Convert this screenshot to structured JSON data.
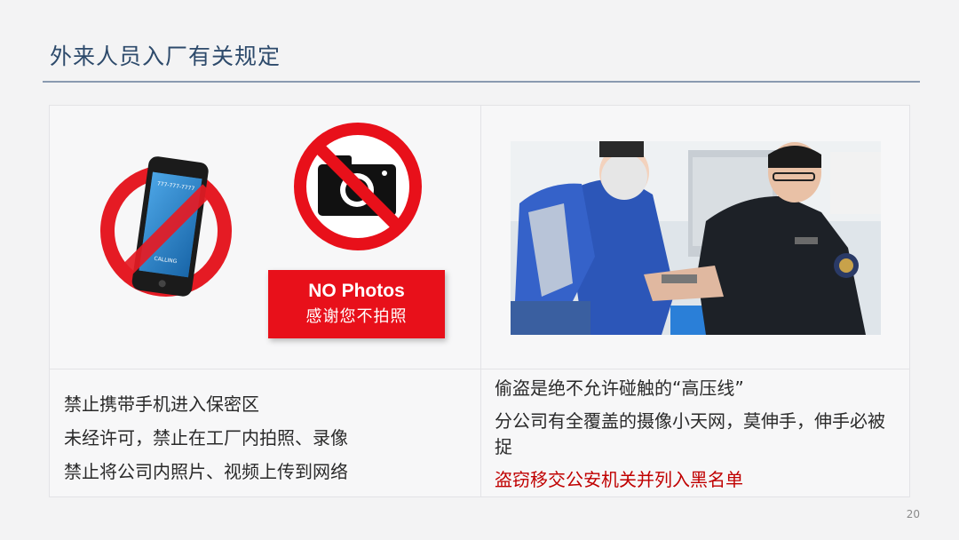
{
  "slide": {
    "title": "外来人员入厂有关规定",
    "page_number": "20"
  },
  "left_panel": {
    "phone_screen_text": "777-777-7777",
    "phone_calling_text": "CALLING",
    "no_photos_en": "NO Photos",
    "no_photos_cn": "感谢您不拍照",
    "rules": [
      "禁止携带手机进入保密区",
      "未经许可，禁止在工厂内拍照、录像",
      "禁止将公司内照片、视频上传到网络"
    ]
  },
  "right_panel": {
    "line1": "偷盗是绝不允许碰触的“高压线”",
    "line2": "分公司有全覆盖的摄像小天网，莫伸手，伸手必被捉",
    "warning": "盗窃移交公安机关并列入黑名单"
  },
  "colors": {
    "title": "#2d4a6b",
    "prohibition_red": "#e8101a",
    "warning_text": "#c00000"
  }
}
